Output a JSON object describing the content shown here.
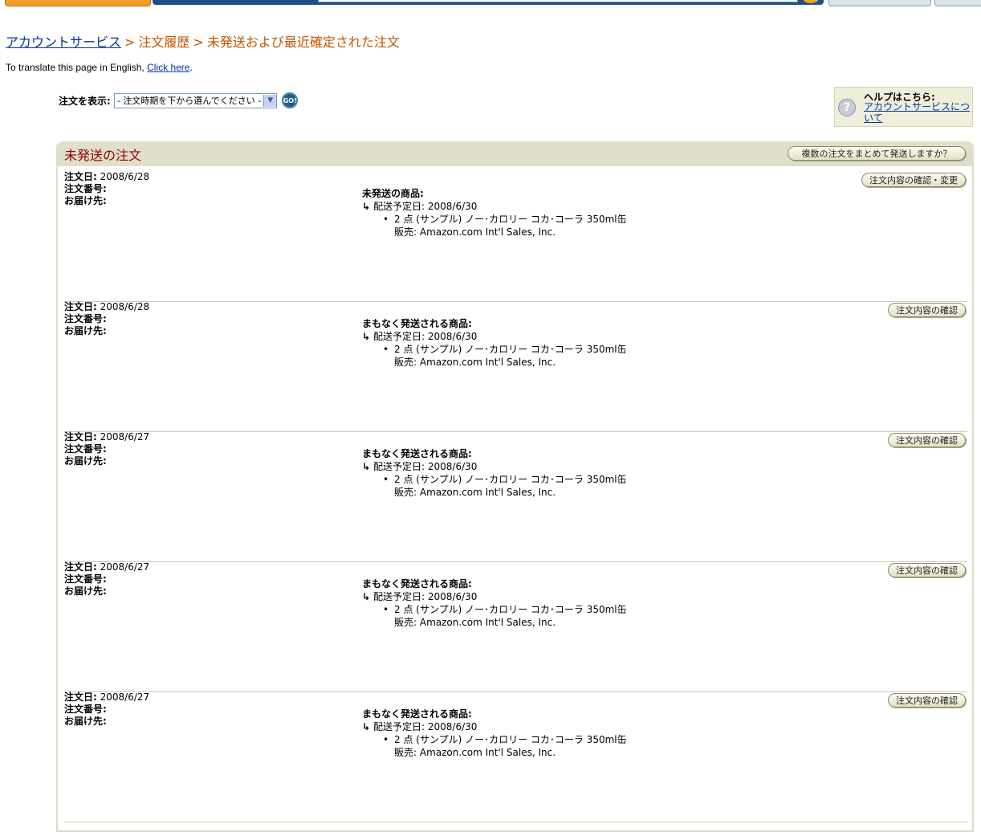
{
  "breadcrumb": {
    "account": "アカウントサービス",
    "sep1": ">",
    "history": "注文履歴",
    "sep2": ">",
    "current": "未発送および最近確定された注文"
  },
  "translate": {
    "text": "To translate this page in English,",
    "link": "Click here",
    "period": "."
  },
  "filter": {
    "label": "注文を表示:",
    "selected": "- 注文時期を下から選んでください -",
    "go": "GO!"
  },
  "help": {
    "title": "ヘルプはこちら:",
    "link": "アカウントサービスについて"
  },
  "panel": {
    "title": "未発送の注文",
    "combine_button": "複数の注文をまとめて発送しますか？"
  },
  "orders": [
    {
      "date_label": "注文日:",
      "date": "2008/6/28",
      "number_label": "注文番号:",
      "address_label": "お届け先:",
      "section": "未発送の商品:",
      "ship_label": "配送予定日:",
      "ship_date": "2008/6/30",
      "item": "2 点 (サンプル) ノー･カロリー コカ･コーラ 350ml缶",
      "seller": "販売: Amazon.com Int'l Sales, Inc.",
      "action": "注文内容の確認・変更"
    },
    {
      "date_label": "注文日:",
      "date": "2008/6/28",
      "number_label": "注文番号:",
      "address_label": "お届け先:",
      "section": "まもなく発送される商品:",
      "ship_label": "配送予定日:",
      "ship_date": "2008/6/30",
      "item": "2 点 (サンプル) ノー･カロリー コカ･コーラ 350ml缶",
      "seller": "販売: Amazon.com Int'l Sales, Inc.",
      "action": "注文内容の確認"
    },
    {
      "date_label": "注文日:",
      "date": "2008/6/27",
      "number_label": "注文番号:",
      "address_label": "お届け先:",
      "section": "まもなく発送される商品:",
      "ship_label": "配送予定日:",
      "ship_date": "2008/6/30",
      "item": "2 点 (サンプル) ノー･カロリー コカ･コーラ 350ml缶",
      "seller": "販売: Amazon.com Int'l Sales, Inc.",
      "action": "注文内容の確認"
    },
    {
      "date_label": "注文日:",
      "date": "2008/6/27",
      "number_label": "注文番号:",
      "address_label": "お届け先:",
      "section": "まもなく発送される商品:",
      "ship_label": "配送予定日:",
      "ship_date": "2008/6/30",
      "item": "2 点 (サンプル) ノー･カロリー コカ･コーラ 350ml缶",
      "seller": "販売: Amazon.com Int'l Sales, Inc.",
      "action": "注文内容の確認"
    },
    {
      "date_label": "注文日:",
      "date": "2008/6/27",
      "number_label": "注文番号:",
      "address_label": "お届け先:",
      "section": "まもなく発送される商品:",
      "ship_label": "配送予定日:",
      "ship_date": "2008/6/30",
      "item": "2 点 (サンプル) ノー･カロリー コカ･コーラ 350ml缶",
      "seller": "販売: Amazon.com Int'l Sales, Inc.",
      "action": "注文内容の確認"
    }
  ],
  "colors": {
    "breadcrumb": "#c45500",
    "link": "#003399",
    "panel_title": "#990000",
    "panel_header": "#dfdfcb"
  }
}
